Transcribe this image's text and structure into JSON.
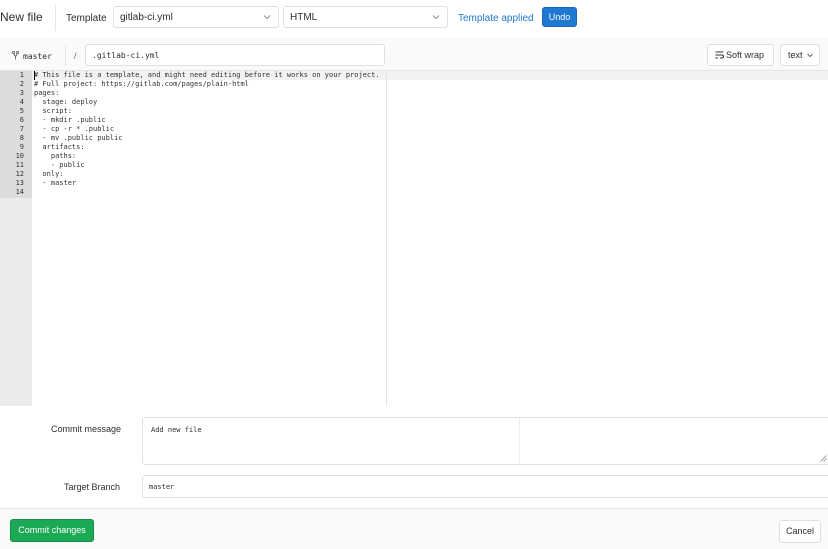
{
  "header": {
    "title": "New file",
    "template_label": "Template",
    "template_dropdown": {
      "value": "gitlab-ci.yml"
    },
    "type_dropdown": {
      "value": "HTML"
    },
    "template_applied_text": "Template applied",
    "undo_label": "Undo"
  },
  "toolbar": {
    "branch_name": "master",
    "path_separator": "/",
    "file_name": ".gitlab-ci.yml",
    "soft_wrap_label": "Soft wrap",
    "mode_value": "text"
  },
  "editor": {
    "line_numbers": [
      "1",
      "2",
      "3",
      "4",
      "5",
      "6",
      "7",
      "8",
      "9",
      "10",
      "11",
      "12",
      "13",
      "14"
    ],
    "lines": [
      "# This file is a template, and might need editing before it works on your project.",
      "# Full project: https://gitlab.com/pages/plain-html",
      "pages:",
      "  stage: deploy",
      "  script:",
      "  - mkdir .public",
      "  - cp -r * .public",
      "  - mv .public public",
      "  artifacts:",
      "    paths:",
      "    - public",
      "  only:",
      "  - master",
      ""
    ]
  },
  "commit": {
    "message_label": "Commit message",
    "message_value": "Add new file",
    "target_branch_label": "Target Branch",
    "target_branch_value": "master",
    "commit_button_label": "Commit changes",
    "cancel_button_label": "Cancel"
  },
  "colors": {
    "primary_blue": "#1f78d1",
    "success_green": "#1aaa55",
    "gutter_bg": "#ebebeb"
  },
  "icons": {
    "branch": "branch-icon",
    "soft_wrap": "soft-wrap-icon",
    "chevron": "chevron-down-icon"
  }
}
